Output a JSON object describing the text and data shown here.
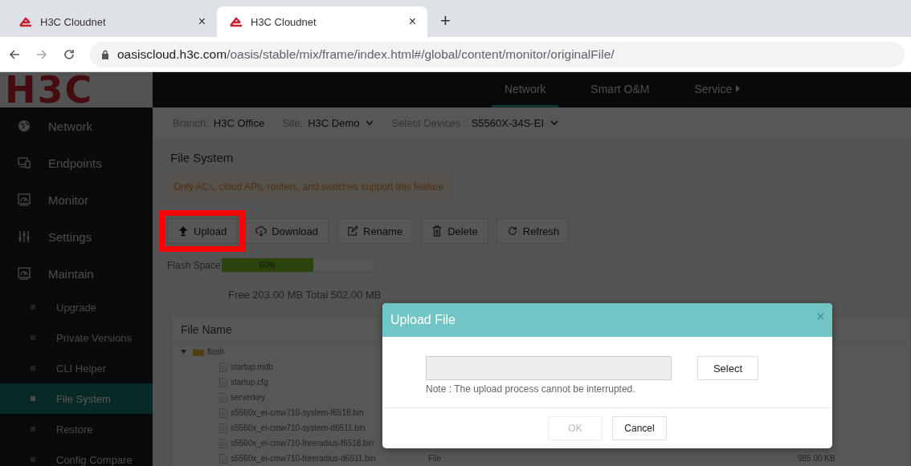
{
  "browser": {
    "tabs": [
      {
        "title": "H3C Cloudnet",
        "selected": false
      },
      {
        "title": "H3C Cloudnet",
        "selected": true
      }
    ],
    "new_tab": "+",
    "close": "×",
    "url_host": "oasiscloud.h3c.com",
    "url_path": "/oasis/stable/mix/frame/index.html#/global/content/monitor/originalFile/"
  },
  "logo": "H3C",
  "top_nav": [
    {
      "label": "Network",
      "selected": true
    },
    {
      "label": "Smart O&M",
      "selected": false
    },
    {
      "label": "Service",
      "selected": false,
      "kind": "menu"
    }
  ],
  "sidebar": [
    {
      "label": "Network",
      "selected": false
    },
    {
      "label": "Endpoints",
      "selected": false
    },
    {
      "label": "Monitor",
      "selected": false
    },
    {
      "label": "Settings",
      "selected": false
    },
    {
      "label": "Maintain",
      "selected": false,
      "children": [
        {
          "label": "Upgrade",
          "selected": false
        },
        {
          "label": "Private Versions",
          "selected": false
        },
        {
          "label": "CLI Helper",
          "selected": false
        },
        {
          "label": "File System",
          "selected": true
        },
        {
          "label": "Restore",
          "selected": false
        },
        {
          "label": "Config Compare",
          "selected": false
        }
      ]
    }
  ],
  "filters": [
    {
      "label": "Branch:",
      "value": "H3C Office",
      "dropdown": false
    },
    {
      "label": "Site:",
      "value": "H3C Demo",
      "dropdown": true
    },
    {
      "label": "Select Devices :",
      "value": "S5560X-34S-EI",
      "dropdown": true
    }
  ],
  "page_title": "File System",
  "notice": "Only ACs, cloud APs, routers, and switches support this feature.",
  "toolbar": [
    {
      "label": "Upload",
      "highlighted": true
    },
    {
      "label": "Download",
      "highlighted": false
    },
    {
      "label": "Rename",
      "highlighted": false
    },
    {
      "label": "Delete",
      "highlighted": false
    },
    {
      "label": "Refresh",
      "highlighted": false
    }
  ],
  "flash_space": {
    "label": "Flash Space",
    "level": 0.6,
    "reading": "60%"
  },
  "space_summary": "Free 203.00 MB Total 502.00 MB",
  "table": {
    "columns": [
      "File Name"
    ],
    "tree": [
      {
        "name": "flash",
        "kind": "folder",
        "expanded": true,
        "children": [
          {
            "name": "startup.mdb",
            "kind": "file"
          },
          {
            "name": "startup.cfg",
            "kind": "file"
          },
          {
            "name": "serverkey",
            "kind": "file"
          },
          {
            "name": "s5560x_ei-cmw710-system-f6518.bin",
            "kind": "file"
          },
          {
            "name": "s5560x_ei-cmw710-system-d6511.bin",
            "kind": "file"
          },
          {
            "name": "s5560x_ei-cmw710-freeradius-f6518.bin",
            "kind": "file"
          },
          {
            "name": "s5560x_ei-cmw710-freeradius-d6511.bin",
            "kind": "file",
            "type": "File",
            "size": "985.00 KB"
          }
        ]
      }
    ]
  },
  "dialog": {
    "title": "Upload File",
    "close": "×",
    "select": "Select",
    "note": "Note : The upload process cannot be interrupted.",
    "buttons": [
      {
        "label": "OK",
        "disabled": true
      },
      {
        "label": "Cancel",
        "disabled": false
      }
    ]
  }
}
